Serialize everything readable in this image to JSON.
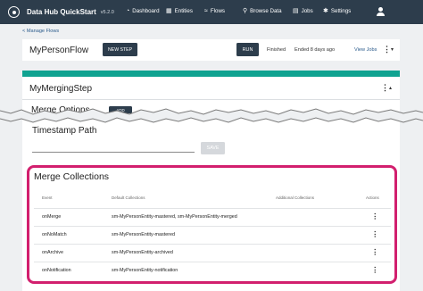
{
  "header": {
    "app_title": "Data Hub QuickStart",
    "version": "v5.2.0",
    "nav": [
      {
        "label": "Dashboard",
        "icon": "dashboard-icon"
      },
      {
        "label": "Entities",
        "icon": "entities-icon"
      },
      {
        "label": "Flows",
        "icon": "flows-icon"
      },
      {
        "label": "Browse Data",
        "icon": "search-icon"
      },
      {
        "label": "Jobs",
        "icon": "jobs-icon"
      },
      {
        "label": "Settings",
        "icon": "gear-icon"
      }
    ],
    "user_icon": "user-icon"
  },
  "breadcrumb": "< Manage Flows",
  "flow": {
    "name": "MyPersonFlow",
    "new_step_label": "NEW STEP",
    "run_label": "RUN",
    "status": "Finished",
    "ended": "Ended 8 days ago",
    "view_jobs": "View Jobs"
  },
  "step": {
    "title": "MyMergingStep",
    "section_title": "Merge Options",
    "add_label": "ADD",
    "timestamp_label": "Timestamp Path",
    "timestamp_value": "",
    "save_label": "SAVE"
  },
  "merge_collections": {
    "title": "Merge Collections",
    "columns": [
      "Event",
      "Default Collections",
      "Additional Collections",
      "Actions"
    ],
    "rows": [
      {
        "event": "onMerge",
        "default": "sm-MyPersonEntity-mastered, sm-MyPersonEntity-merged",
        "additional": ""
      },
      {
        "event": "onNoMatch",
        "default": "sm-MyPersonEntity-mastered",
        "additional": ""
      },
      {
        "event": "onArchive",
        "default": "sm-MyPersonEntity-archived",
        "additional": ""
      },
      {
        "event": "onNotification",
        "default": "sm-MyPersonEntity-notification",
        "additional": ""
      }
    ]
  },
  "colors": {
    "nav_bg": "#2d3d4c",
    "accent": "#10a391",
    "highlight": "#d21f6e",
    "link": "#2c5c8c"
  }
}
